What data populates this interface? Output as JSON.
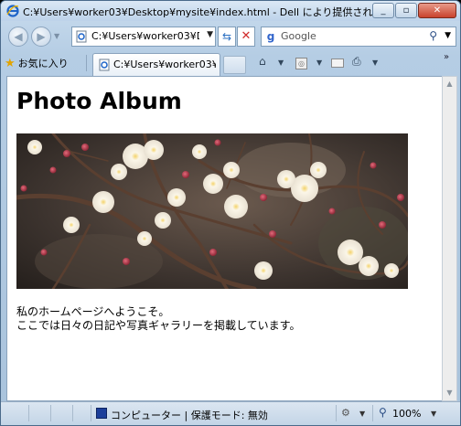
{
  "window": {
    "title": "C:¥Users¥worker03¥Desktop¥mysite¥index.html - Dell により提供された In..."
  },
  "toolbar": {
    "back_icon": "back-arrow-icon",
    "forward_icon": "forward-arrow-icon",
    "address_value": "C:¥Users¥worker03¥De",
    "search_placeholder": "Google"
  },
  "tabbar": {
    "favorites_label": "お気に入り",
    "tab_label": "C:¥Users¥worker03¥..."
  },
  "page": {
    "title": "Photo Album",
    "intro_line1": "私のホームページへようこそ。",
    "intro_line2": "ここでは日々の日記や写真ギャラリーを掲載しています。"
  },
  "status": {
    "zone": "コンピューター | 保護モード: 無効",
    "zoom": "100%"
  },
  "colors": {
    "accent": "#2a6fc2",
    "stop": "#d02b2b",
    "chrome": "#b5cde4"
  }
}
